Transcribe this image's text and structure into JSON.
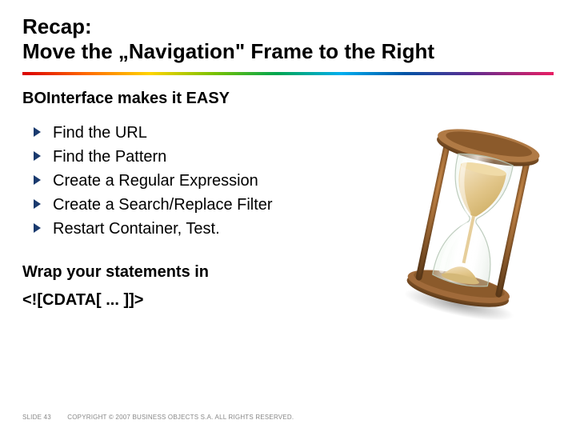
{
  "title_line1": "Recap:",
  "title_line2": "Move the „Navigation\" Frame to the Right",
  "subtitle": "BOInterface makes it EASY",
  "bullets": [
    "Find the URL",
    "Find the Pattern",
    "Create a Regular Expression",
    "Create a Search/Replace Filter",
    "Restart Container, Test."
  ],
  "wrap_heading": "Wrap your statements in",
  "cdata_text": "<![CDATA[ ... ]]>",
  "footer": {
    "slide_label": "SLIDE 43",
    "copyright": "COPYRIGHT © 2007 BUSINESS OBJECTS S.A. ALL RIGHTS RESERVED."
  }
}
